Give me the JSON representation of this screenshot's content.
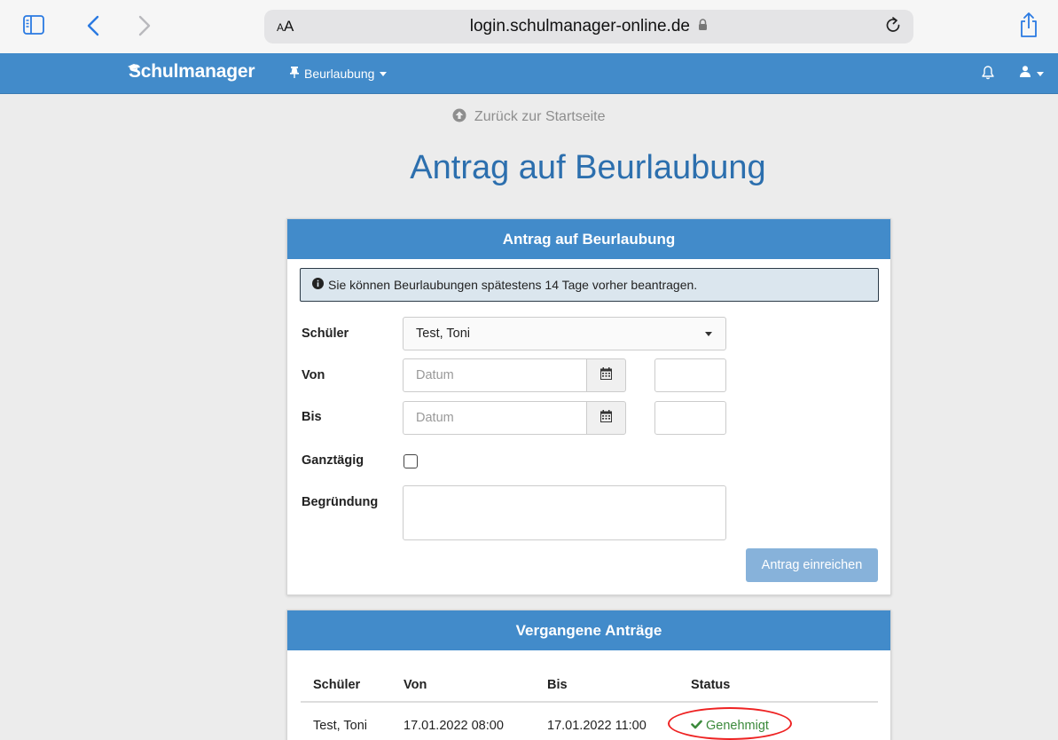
{
  "browser": {
    "aa_label": "AA",
    "url": "login.schulmanager-online.de"
  },
  "navbar": {
    "brand": "Schulmanager",
    "menu_label": "Beurlaubung"
  },
  "page": {
    "back_link": "Zurück zur Startseite",
    "title": "Antrag auf Beurlaubung"
  },
  "form_panel": {
    "heading": "Antrag auf Beurlaubung",
    "info": "Sie können Beurlaubungen spätestens 14 Tage vorher beantragen.",
    "student_label": "Schüler",
    "student_value": "Test, Toni",
    "from_label": "Von",
    "from_placeholder": "Datum",
    "to_label": "Bis",
    "to_placeholder": "Datum",
    "fullday_label": "Ganztägig",
    "reason_label": "Begründung",
    "submit_label": "Antrag einreichen"
  },
  "history_panel": {
    "heading": "Vergangene Anträge",
    "columns": [
      "Schüler",
      "Von",
      "Bis",
      "Status"
    ],
    "rows": [
      {
        "student": "Test, Toni",
        "from": "17.01.2022 08:00",
        "to": "17.01.2022 11:00",
        "status": "Genehmigt"
      }
    ]
  },
  "colors": {
    "navbar": "#428bca",
    "title": "#2c6fae",
    "approved": "#3c8a3c",
    "annotation": "#e22222"
  }
}
